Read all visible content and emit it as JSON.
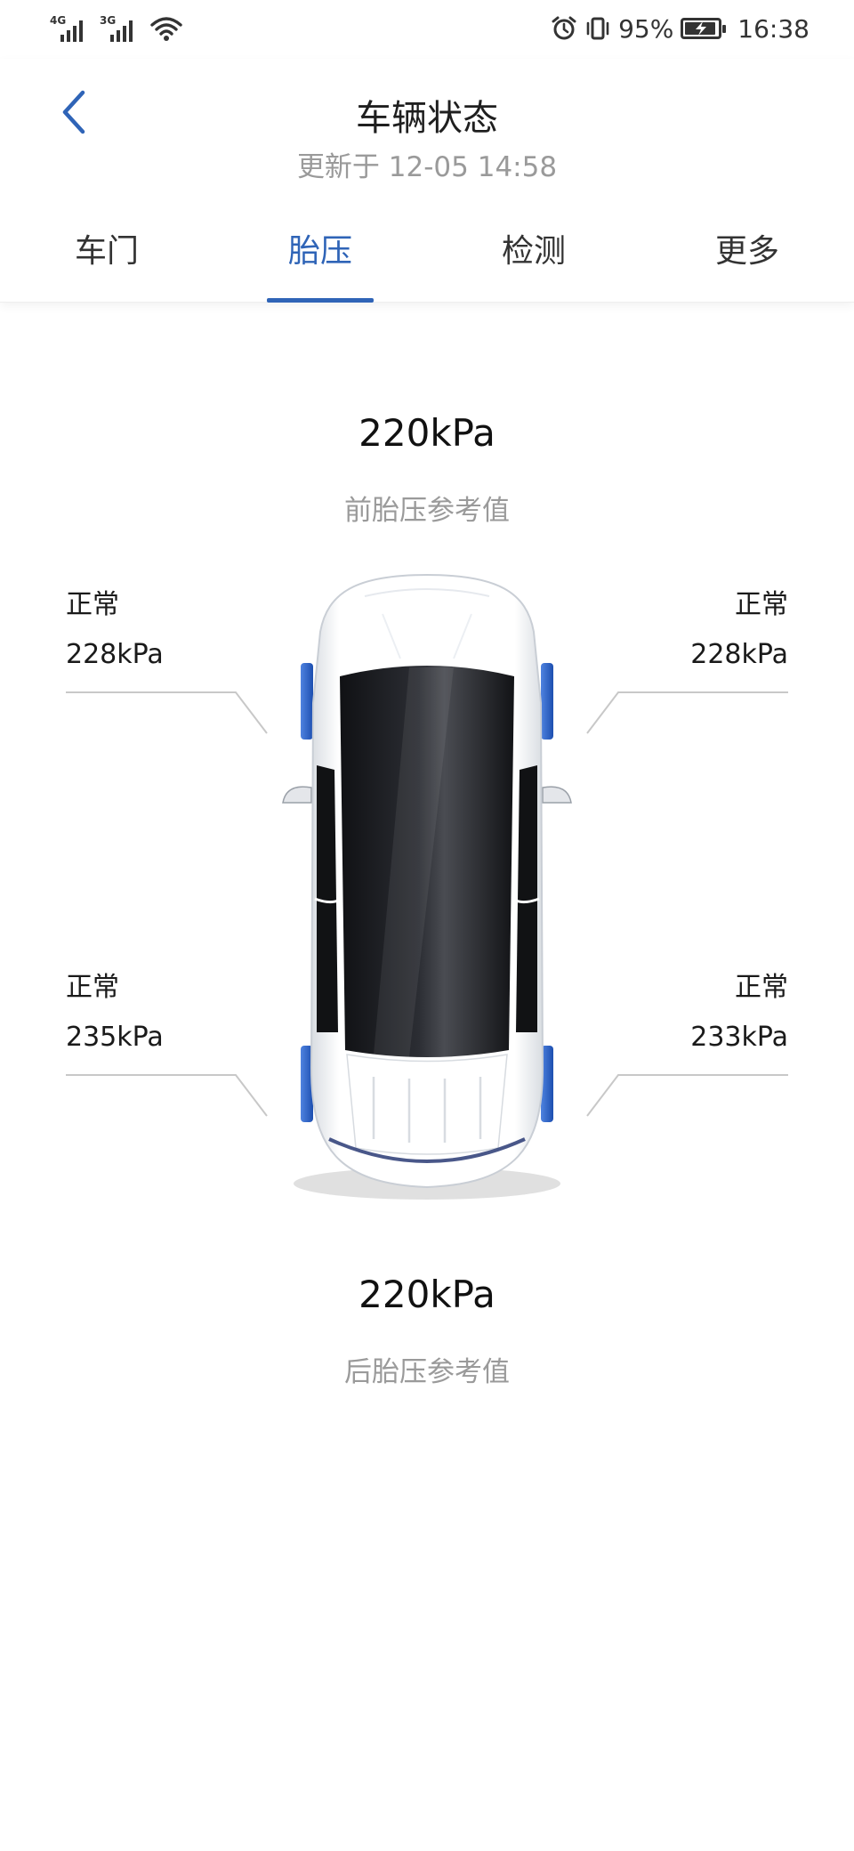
{
  "status_bar": {
    "net1": "4G",
    "net2": "3G",
    "battery_percent_text": "95%",
    "battery_level": 0.95,
    "time": "16:38"
  },
  "header": {
    "title": "车辆状态",
    "updated": "更新于 12-05 14:58"
  },
  "tabs": [
    {
      "label": "车门",
      "active": false
    },
    {
      "label": "胎压",
      "active": true
    },
    {
      "label": "检测",
      "active": false
    },
    {
      "label": "更多",
      "active": false
    }
  ],
  "front_reference": {
    "value": "220kPa",
    "label": "前胎压参考值"
  },
  "rear_reference": {
    "value": "220kPa",
    "label": "后胎压参考值"
  },
  "tires": {
    "front_left": {
      "status": "正常",
      "pressure": "228kPa"
    },
    "front_right": {
      "status": "正常",
      "pressure": "228kPa"
    },
    "rear_left": {
      "status": "正常",
      "pressure": "235kPa"
    },
    "rear_right": {
      "status": "正常",
      "pressure": "233kPa"
    }
  },
  "colors": {
    "accent": "#2f64b7",
    "text_secondary": "#9a9a9a",
    "tire_highlight": "#3a6fd0"
  },
  "icons": {
    "back": "chevron-left-icon",
    "alarm": "alarm-icon",
    "vibrate": "vibrate-icon",
    "wifi": "wifi-icon",
    "charging": "charging-icon"
  }
}
